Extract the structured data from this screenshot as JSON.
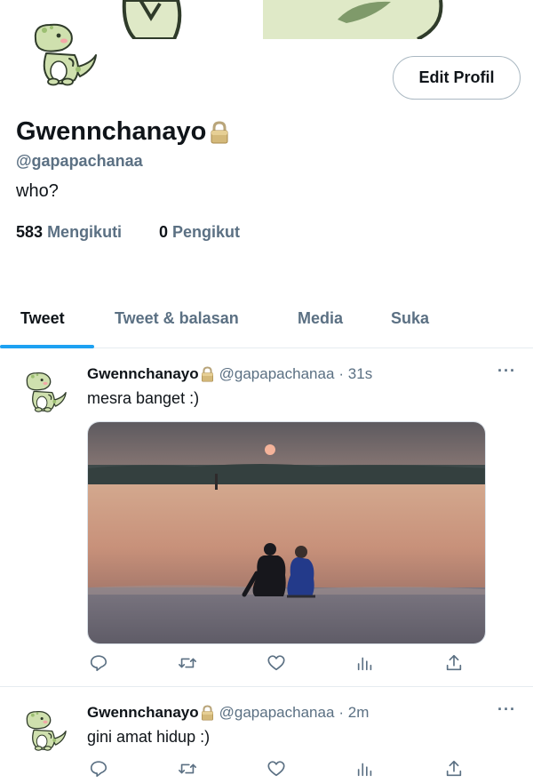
{
  "profile": {
    "display_name": "Gwennchanayo",
    "handle": "@gapapachanaa",
    "bio": "who?",
    "following_count": "583",
    "following_label": "Mengikuti",
    "followers_count": "0",
    "followers_label": "Pengikut",
    "edit_button": "Edit Profil",
    "avatar_icon": "dinosaur-mascot-icon",
    "protected_icon": "lock-icon"
  },
  "tabs": [
    {
      "label": "Tweet",
      "active": true
    },
    {
      "label": "Tweet & balasan",
      "active": false
    },
    {
      "label": "Media",
      "active": false
    },
    {
      "label": "Suka",
      "active": false
    }
  ],
  "tweets": [
    {
      "name": "Gwennchanayo",
      "handle": "@gapapachanaa",
      "time": "· 31s",
      "text": "mesra banget :)",
      "has_media": true,
      "media_icon": "sunset-beach-couple-photo"
    },
    {
      "name": "Gwennchanayo",
      "handle": "@gapapachanaa",
      "time": "· 2m",
      "text": "gini amat hidup :)",
      "has_media": false
    }
  ],
  "more_glyph": "···",
  "action_icons": [
    "reply-icon",
    "retweet-icon",
    "like-icon",
    "analytics-icon",
    "share-icon"
  ],
  "colors": {
    "accent": "#1da1f2",
    "secondary_text": "#5b7083",
    "primary_text": "#0f1419",
    "divider": "#e6ecf0",
    "mascot_green": "#cfe0ae"
  }
}
